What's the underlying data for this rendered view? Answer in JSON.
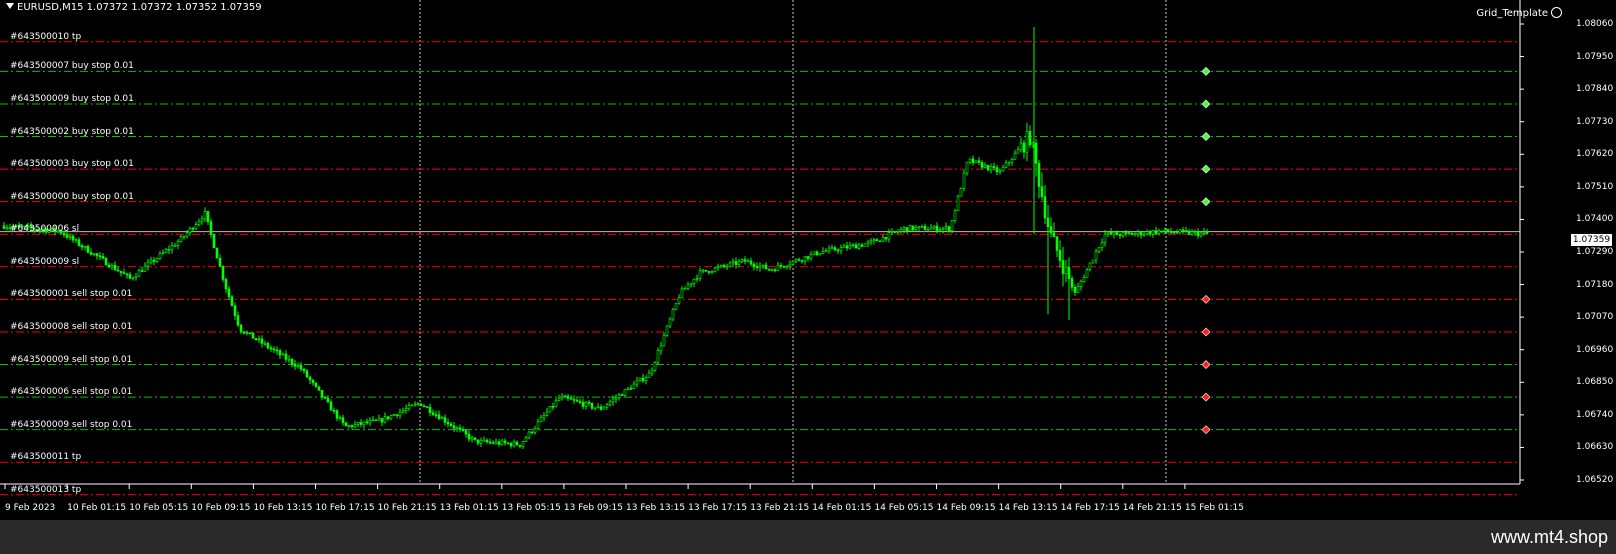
{
  "header": {
    "symbol_info": "EURUSD,M15  1.07372 1.07372 1.07352 1.07359"
  },
  "expert": {
    "name": "Grid_Template"
  },
  "current_price": "1.07359",
  "price_axis": [
    "1.08060",
    "1.07950",
    "1.07840",
    "1.07730",
    "1.07620",
    "1.07510",
    "1.07400",
    "1.07290",
    "1.07180",
    "1.07070",
    "1.06960",
    "1.06850",
    "1.06740",
    "1.06630",
    "1.06520"
  ],
  "time_axis": [
    "9 Feb 2023",
    "10 Feb 01:15",
    "10 Feb 05:15",
    "10 Feb 09:15",
    "10 Feb 13:15",
    "10 Feb 17:15",
    "10 Feb 21:15",
    "13 Feb 01:15",
    "13 Feb 05:15",
    "13 Feb 09:15",
    "13 Feb 13:15",
    "13 Feb 17:15",
    "13 Feb 21:15",
    "14 Feb 01:15",
    "14 Feb 05:15",
    "14 Feb 09:15",
    "14 Feb 13:15",
    "14 Feb 17:15",
    "14 Feb 21:15",
    "15 Feb 01:15"
  ],
  "order_labels": [
    {
      "text": "#643500010 tp",
      "color": "red",
      "marker": "none",
      "price": 1.08
    },
    {
      "text": "#643500007 buy stop 0.01",
      "color": "green",
      "marker": "buy",
      "price": 1.079
    },
    {
      "text": "#643500009 buy stop 0.01",
      "color": "green",
      "marker": "buy",
      "price": 1.0779
    },
    {
      "text": "#643500002 buy stop 0.01",
      "color": "green",
      "marker": "buy",
      "price": 1.0768
    },
    {
      "text": "#643500003 buy stop 0.01",
      "color": "red",
      "marker": "buy",
      "price": 1.0757
    },
    {
      "text": "#643500000 buy stop 0.01",
      "color": "red",
      "marker": "buy",
      "price": 1.0746
    },
    {
      "text": "#643500006 sl",
      "color": "red",
      "marker": "none",
      "price": 1.0735
    },
    {
      "text": "#643500009 sl",
      "color": "red",
      "marker": "none",
      "price": 1.0724
    },
    {
      "text": "#643500001 sell stop 0.01",
      "color": "red",
      "marker": "sell",
      "price": 1.0713
    },
    {
      "text": "#643500008 sell stop 0.01",
      "color": "red",
      "marker": "sell",
      "price": 1.0702
    },
    {
      "text": "#643500009 sell stop 0.01",
      "color": "green",
      "marker": "sell",
      "price": 1.0691
    },
    {
      "text": "#643500006 sell stop 0.01",
      "color": "green",
      "marker": "sell",
      "price": 1.068
    },
    {
      "text": "#643500009 sell stop 0.01",
      "color": "green",
      "marker": "sell",
      "price": 1.0669
    },
    {
      "text": "#643500011 tp",
      "color": "red",
      "marker": "none",
      "price": 1.0658
    },
    {
      "text": "#643500013 tp",
      "color": "red",
      "marker": "none",
      "price": 1.0647
    }
  ],
  "colors": {
    "background": "#000000",
    "candle": "#00ff00",
    "tp_sl_line": "#ff0000",
    "pending_line": "#00c000",
    "grid": "#ffffff"
  },
  "watermark": "www.mt4.shop"
}
